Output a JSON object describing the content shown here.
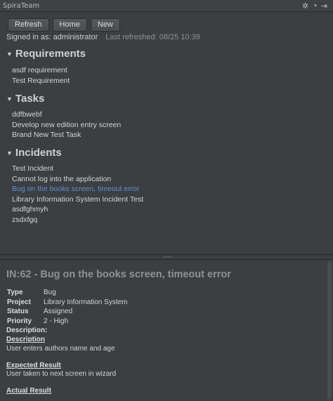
{
  "window": {
    "title": "SpiraTeam",
    "settings_icon": "gear-icon",
    "settings_arrow": "▾",
    "hide_icon": "pin-icon"
  },
  "toolbar": {
    "refresh_label": "Refresh",
    "home_label": "Home",
    "new_label": "New"
  },
  "status": {
    "signed_in": "Signed in as: administrator",
    "last_refreshed": "Last refreshed: 08/25 10:39"
  },
  "sections": {
    "requirements": {
      "title": "Requirements",
      "items": [
        "asdf requirement",
        "Test Requirement"
      ]
    },
    "tasks": {
      "title": "Tasks",
      "items": [
        "ddfbwebf",
        "Develop new edition entry screen",
        "Brand New Test Task"
      ]
    },
    "incidents": {
      "title": "Incidents",
      "items": [
        "Test Incident",
        "Cannot log into the application",
        "Bug on the books screen, timeout error",
        "Library Information System Incident Test",
        "asdfghmyh",
        "zsdxfgq"
      ],
      "selected_index": 2
    }
  },
  "detail": {
    "title": "IN:62 - Bug on the books screen, timeout error",
    "type_label": "Type",
    "type_value": "Bug",
    "project_label": "Project",
    "project_value": "Library Information System",
    "status_label": "Status",
    "status_value": "Assigned",
    "priority_label": "Priority",
    "priority_value": "2 - High",
    "description_label": "Description:",
    "description_heading": "Description",
    "description_text": "User enters authors name and age",
    "expected_heading": "Expected Result",
    "expected_text": "User taken to next screen in wizard",
    "actual_heading": "Actual Result"
  },
  "colors": {
    "background": "#3c3f41",
    "selected_link": "#5f90d6",
    "detail_title": "#8f9294"
  }
}
